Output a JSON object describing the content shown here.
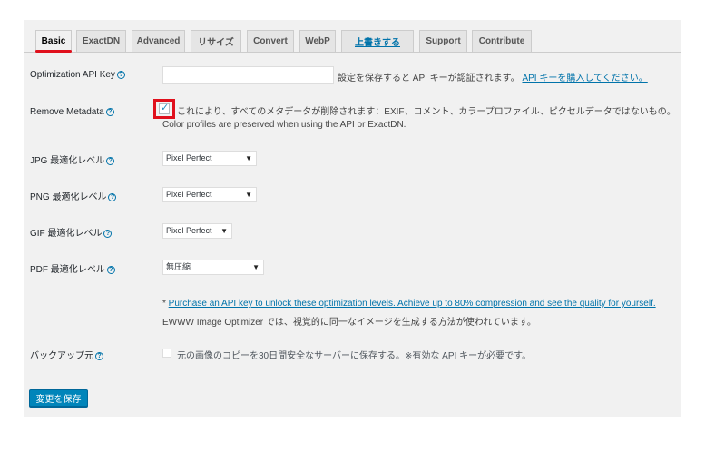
{
  "tabs": [
    {
      "label": "Basic"
    },
    {
      "label": "ExactDN"
    },
    {
      "label": "Advanced"
    },
    {
      "label": "リサイズ"
    },
    {
      "label": "Convert"
    },
    {
      "label": "WebP"
    },
    {
      "label": "上書きする"
    },
    {
      "label": "Support"
    },
    {
      "label": "Contribute"
    }
  ],
  "api_key": {
    "label": "Optimization API Key",
    "value": "",
    "hint": "設定を保存すると API キーが認証されます。",
    "purchase_link": "API キーを購入してください。"
  },
  "metadata": {
    "label": "Remove Metadata",
    "checked": true,
    "description": "これにより、すべてのメタデータが削除されます：EXIF、コメント、カラープロファイル、ピクセルデータではないもの。",
    "note": "Color profiles are preserved when using the API or ExactDN."
  },
  "jpg": {
    "label": "JPG 最適化レベル",
    "selected": "Pixel Perfect"
  },
  "png": {
    "label": "PNG 最適化レベル",
    "selected": "Pixel Perfect"
  },
  "gif": {
    "label": "GIF 最適化レベル",
    "selected": "Pixel Perfect"
  },
  "pdf": {
    "label": "PDF 最適化レベル",
    "selected": "無圧縮"
  },
  "optimization_note": {
    "asterisk": "* ",
    "link": "Purchase an API key to unlock these optimization levels. Achieve up to 80% compression and see the quality for yourself.",
    "line2": "EWWW Image Optimizer では、視覚的に同一なイメージを生成する方法が使われています。"
  },
  "backup": {
    "label": "バックアップ元",
    "checked": false,
    "description": "元の画像のコピーを30日間安全なサーバーに保存する。※有効な API キーが必要です。"
  },
  "save_label": "変更を保存",
  "help_glyph": "?",
  "arrow_glyph": "▼",
  "tick_glyph": "✓",
  "colors": {
    "accent": "#0073aa",
    "button": "#0085ba",
    "highlight": "#e0101c"
  }
}
